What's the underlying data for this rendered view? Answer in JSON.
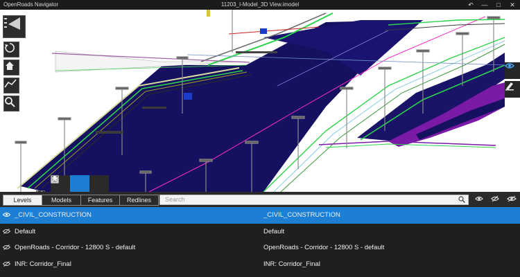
{
  "window": {
    "app_title": "OpenRoads Navigator",
    "document_title": "11203_I-Model_3D View.imodel",
    "controls": [
      {
        "name": "back-icon",
        "glyph": "↶"
      },
      {
        "name": "minimize-icon",
        "glyph": "—"
      },
      {
        "name": "maximize-icon",
        "glyph": "□"
      },
      {
        "name": "close-icon",
        "glyph": "✕"
      }
    ]
  },
  "toolbar_left": [
    {
      "name": "menu-icon"
    },
    {
      "name": "rotate-icon"
    },
    {
      "name": "home-icon"
    },
    {
      "name": "measure-icon"
    },
    {
      "name": "zoom-icon"
    }
  ],
  "toolbar_right": [
    {
      "name": "visibility-icon"
    },
    {
      "name": "markup-icon"
    }
  ],
  "view_tabs": [
    {
      "name": "view-tab-saved-views",
      "icon": "image-icon"
    },
    {
      "name": "view-tab-layers",
      "icon": "layers-icon",
      "active": true
    },
    {
      "name": "view-tab-properties",
      "icon": "properties-icon"
    }
  ],
  "panel": {
    "tabs": [
      {
        "label": "Levels",
        "active": true
      },
      {
        "label": "Models"
      },
      {
        "label": "Features"
      },
      {
        "label": "Redlines"
      }
    ],
    "search_placeholder": "Search",
    "visibility_controls": [
      {
        "name": "show-all-icon"
      },
      {
        "name": "hide-all-icon"
      },
      {
        "name": "invert-visibility-icon"
      }
    ]
  },
  "levels": [
    {
      "name": "_CIVIL_CONSTRUCTION",
      "display": "_CIVIL_CONSTRUCTION",
      "selected": true
    },
    {
      "name": "Default",
      "display": "Default"
    },
    {
      "name": "OpenRoads - Corridor - 12800 S - default",
      "display": "OpenRoads - Corridor - 12800 S - default"
    },
    {
      "name": "INR: Corridor_Final",
      "display": "INR: Corridor_Final"
    }
  ],
  "colors": {
    "selection": "#1c7fd4",
    "roadway_fill": "#15105f",
    "median_green": "#2bd44a",
    "edge_purple": "#7a1aa6",
    "centerline_magenta": "#ff2fc8"
  }
}
